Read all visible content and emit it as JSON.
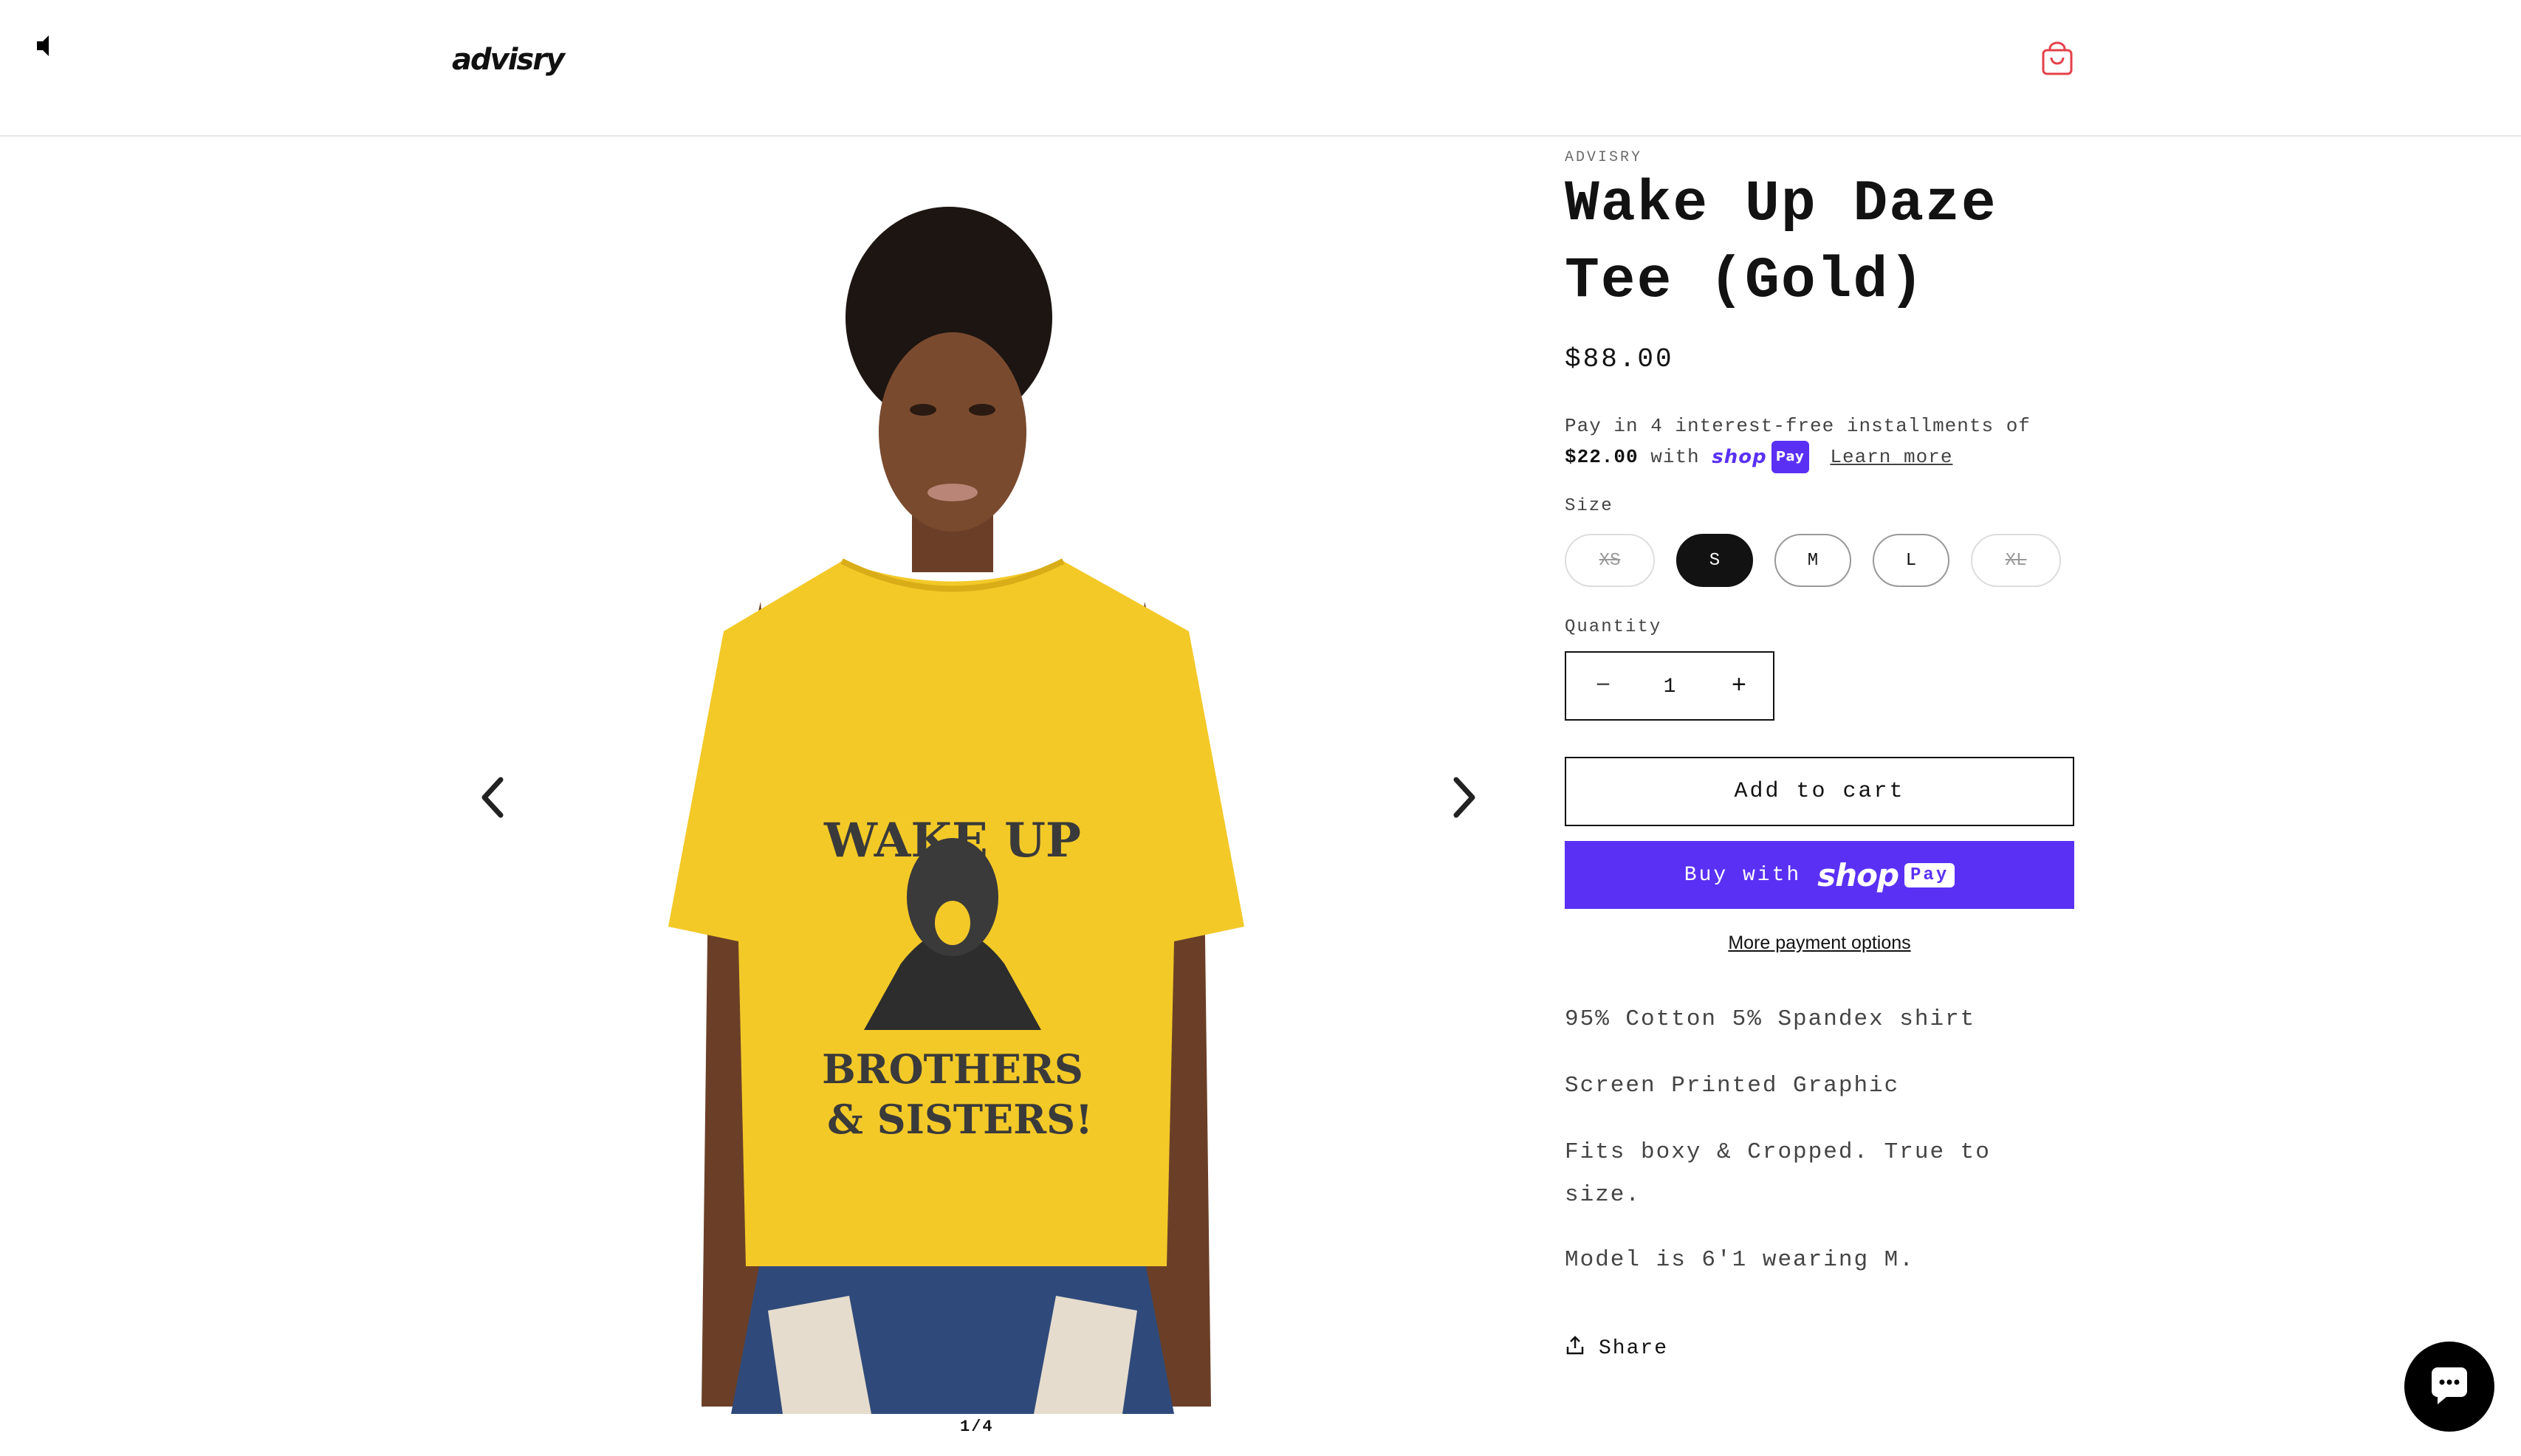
{
  "header": {
    "logo_text": "advisry",
    "icons": [
      "speaker-muted-icon",
      "shopping-bag-icon"
    ],
    "accent_color": "#e4414a"
  },
  "gallery": {
    "slide_counter": "1/4",
    "shirt_print_top": "WAKE UP",
    "shirt_print_bottom_1": "BROTHERS",
    "shirt_print_bottom_2": "& SISTERS!",
    "shirt_color": "#f3c928"
  },
  "product": {
    "vendor": "ADVISRY",
    "title_line_1": "Wake Up Daze",
    "title_line_2": "Tee (Gold)",
    "price": "$88.00",
    "installments": {
      "line_1": "Pay in 4 interest-free installments of",
      "amount": "$22.00",
      "with": "with",
      "shop_word": "shop",
      "pay_badge": "Pay",
      "learn_more": "Learn more"
    },
    "size_label": "Size",
    "sizes": [
      {
        "label": "XS",
        "state": "unavailable"
      },
      {
        "label": "S",
        "state": "selected"
      },
      {
        "label": "M",
        "state": "available"
      },
      {
        "label": "L",
        "state": "available"
      },
      {
        "label": "XL",
        "state": "unavailable"
      }
    ],
    "quantity_label": "Quantity",
    "quantity_value": "1",
    "quantity_minus": "−",
    "quantity_plus": "+",
    "add_to_cart": "Add to cart",
    "buy_now": {
      "prefix": "Buy with",
      "shop_word": "shop",
      "pay_badge": "Pay",
      "color": "#5a31f4"
    },
    "more_payment_options": "More payment options",
    "description": [
      "95% Cotton 5% Spandex shirt",
      "Screen Printed Graphic",
      "Fits boxy & Cropped. True to size.",
      "Model is 6'1 wearing M."
    ],
    "share": "Share"
  },
  "chat": {
    "icon": "chat-icon"
  }
}
